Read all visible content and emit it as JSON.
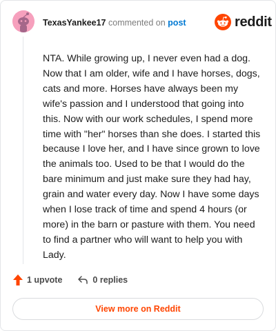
{
  "comment": {
    "username": "TexasYankee17",
    "action_text": "commented on",
    "target_label": "post",
    "body": "NTA. While growing up, I never even had a dog. Now that I am older, wife and I have horses, dogs, cats and more. Horses have always been my wife's passion and I understood that going into this. Now with our work schedules, I spend more time with \"her\" horses than she does. I started this because I love her, and I have since grown to love the animals too. Used to be that I would do the bare minimum and just make sure they had hay, grain and water every day. Now I have some days when I lose track of time and spend 4 hours (or more) in the barn or pasture with them. You need to find a partner who will want to help you with Lady."
  },
  "brand": {
    "name": "reddit",
    "icon": "reddit-logo-icon",
    "color": "#ff4500"
  },
  "actions": {
    "upvote_label": "1 upvote",
    "upvote_icon": "upvote-arrow-icon",
    "upvote_color": "#ff4500",
    "replies_label": "0 replies",
    "replies_icon": "reply-arrow-icon"
  },
  "footer": {
    "view_more_label": "View more on Reddit"
  },
  "avatar": {
    "icon": "snoo-avatar-icon",
    "color": "#f6a0bd"
  }
}
